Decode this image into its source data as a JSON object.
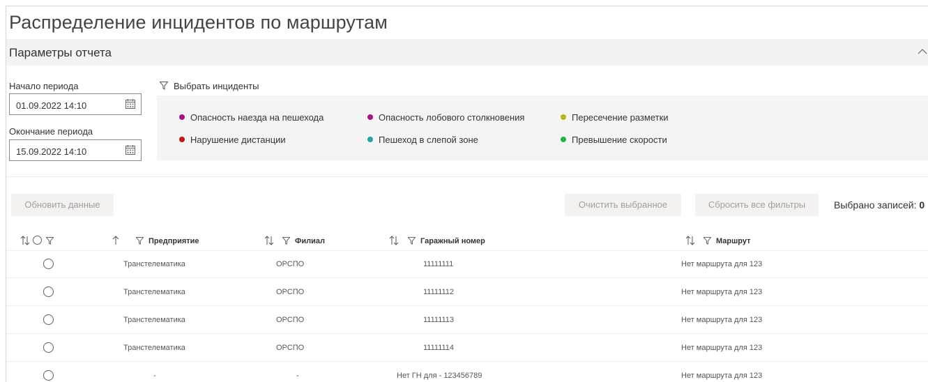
{
  "page": {
    "title": "Распределение инцидентов по маршрутам"
  },
  "params": {
    "title": "Параметры отчета",
    "start_label": "Начало периода",
    "start_value": "01.09.2022 14:10",
    "end_label": "Окончание периода",
    "end_value": "15.09.2022 14:10",
    "filter_label": "Выбрать инциденты"
  },
  "incidents": [
    {
      "label": "Опасность наезда на пешехода",
      "color": "#a4148d"
    },
    {
      "label": "Опасность лобового столкновения",
      "color": "#a4148d"
    },
    {
      "label": "Пересечение разметки",
      "color": "#b4b61a"
    },
    {
      "label": "Нарушение дистанции",
      "color": "#c0161c"
    },
    {
      "label": "Пешеход в слепой зоне",
      "color": "#1aa89b"
    },
    {
      "label": "Превышение скорости",
      "color": "#22b34a"
    }
  ],
  "toolbar": {
    "refresh": "Обновить данные",
    "clear_selected": "Очистить выбранное",
    "reset_filters": "Сбросить все фильтры",
    "selected_label": "Выбрано записей:",
    "selected_count": "0"
  },
  "table": {
    "columns": [
      "Предприятие",
      "Филиал",
      "Гаражный номер",
      "Маршрут"
    ],
    "rows": [
      {
        "enterprise": "Транстелематика",
        "branch": "ОРСПО",
        "garage": "11111111",
        "route": "Нет маршрута для 123"
      },
      {
        "enterprise": "Транстелематика",
        "branch": "ОРСПО",
        "garage": "11111112",
        "route": "Нет маршрута для 123"
      },
      {
        "enterprise": "Транстелематика",
        "branch": "ОРСПО",
        "garage": "11111113",
        "route": "Нет маршрута для 123"
      },
      {
        "enterprise": "Транстелематика",
        "branch": "ОРСПО",
        "garage": "11111114",
        "route": "Нет маршрута для 123"
      },
      {
        "enterprise": "-",
        "branch": "-",
        "garage": "Нет ГН для - 123456789",
        "route": "Нет маршрута для 123"
      }
    ]
  }
}
